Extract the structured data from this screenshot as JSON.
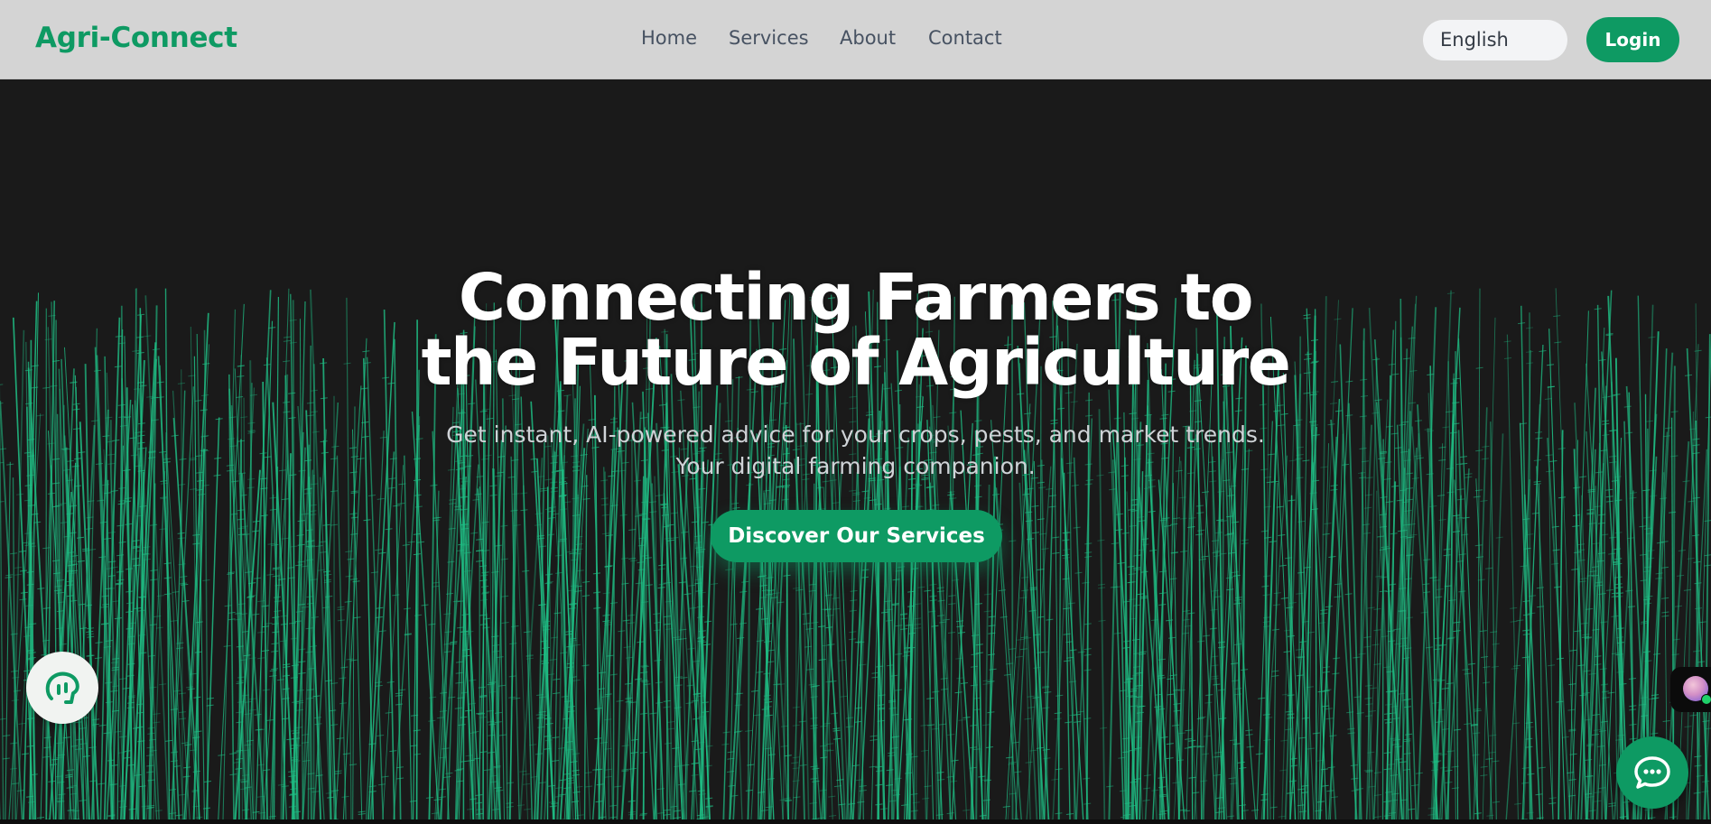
{
  "header": {
    "logo": "Agri-Connect",
    "nav": [
      "Home",
      "Services",
      "About",
      "Contact"
    ],
    "language": "English",
    "login_label": "Login"
  },
  "hero": {
    "title_line1": "Connecting Farmers to",
    "title_line2": "the Future of Agriculture",
    "subtitle": "Get instant, AI-powered advice for your crops, pests, and market trends. Your digital farming companion.",
    "cta_label": "Discover Our Services"
  },
  "floating": {
    "accessibility_icon": "hearing-head-icon",
    "avatar_icon": "assistant-avatar-icon",
    "chat_icon": "chat-bubble-icon"
  },
  "colors": {
    "brand": "#0e9a63",
    "header_bg": "#d4d4d4",
    "hero_bg": "#1a1a1a",
    "grass": "#1fbf85",
    "nav_text": "#475262"
  }
}
